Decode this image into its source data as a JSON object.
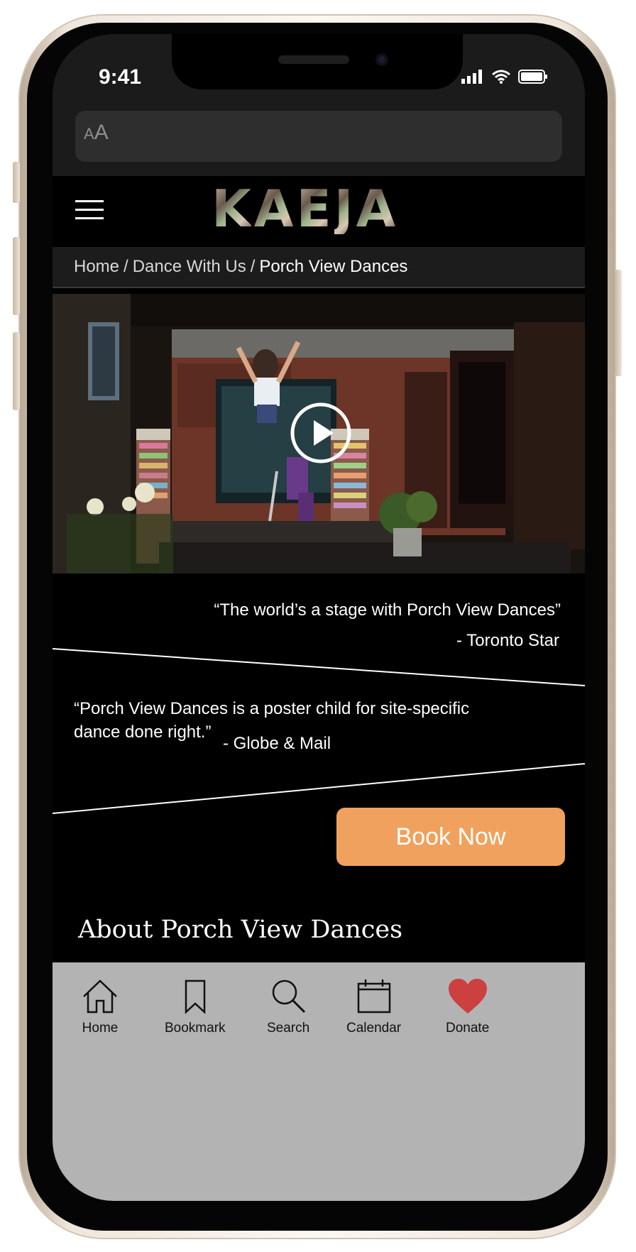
{
  "status_bar": {
    "time": "9:41"
  },
  "browser": {
    "text_size_label": "AA"
  },
  "site": {
    "logo_letters": [
      "K",
      "A",
      "E",
      "J",
      "A"
    ]
  },
  "breadcrumb": {
    "items": [
      "Home",
      "Dance With Us"
    ],
    "separator": "/",
    "current": "Porch View Dances"
  },
  "quotes": [
    {
      "text": "“The world’s a stage with Porch View Dances”",
      "source": "- Toronto Star"
    },
    {
      "text": "“Porch View Dances is a poster child for site-specific dance done right.”",
      "source": "- Globe & Mail"
    }
  ],
  "cta": {
    "book_label": "Book Now"
  },
  "about": {
    "heading": "About Porch View Dances"
  },
  "tab_bar": {
    "items": [
      {
        "label": "Home",
        "icon": "home-icon"
      },
      {
        "label": "Bookmark",
        "icon": "bookmark-icon"
      },
      {
        "label": "Search",
        "icon": "search-icon"
      },
      {
        "label": "Calendar",
        "icon": "calendar-icon"
      },
      {
        "label": "Donate",
        "icon": "heart-icon"
      }
    ]
  },
  "colors": {
    "accent": "#f0a15d",
    "donate_heart": "#cc4040",
    "tab_bar_bg": "#b3b3b3"
  }
}
